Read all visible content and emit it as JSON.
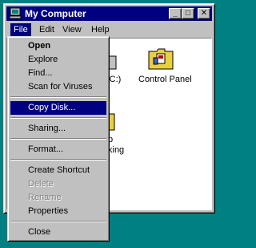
{
  "window": {
    "title": "My Computer",
    "controls": {
      "minimize": "_",
      "maximize": "□",
      "close": "✕"
    }
  },
  "menubar": {
    "items": [
      "File",
      "Edit",
      "View",
      "Help"
    ]
  },
  "content": {
    "icons": [
      {
        "label": "(C:)",
        "icon": "hard-drive-icon"
      },
      {
        "label": "Control Panel",
        "icon": "control-panel-icon"
      },
      {
        "label": "p",
        "icon": "dial-up-networking-icon"
      },
      {
        "label": "king",
        "icon": "dial-up-networking-icon"
      }
    ]
  },
  "file_menu": {
    "items": [
      {
        "label": "Open",
        "style": "bold"
      },
      {
        "label": "Explore"
      },
      {
        "label": "Find..."
      },
      {
        "label": "Scan for Viruses"
      },
      {
        "label": "Copy Disk...",
        "style": "selected"
      },
      {
        "label": "Sharing..."
      },
      {
        "label": "Format..."
      },
      {
        "label": "Create Shortcut"
      },
      {
        "label": "Delete",
        "style": "disabled"
      },
      {
        "label": "Rename",
        "style": "disabled"
      },
      {
        "label": "Properties"
      },
      {
        "label": "Close"
      }
    ]
  },
  "colors": {
    "desktop": "#008080",
    "titlebar": "#000080",
    "face": "#c0c0c0",
    "highlight": "#000080"
  }
}
